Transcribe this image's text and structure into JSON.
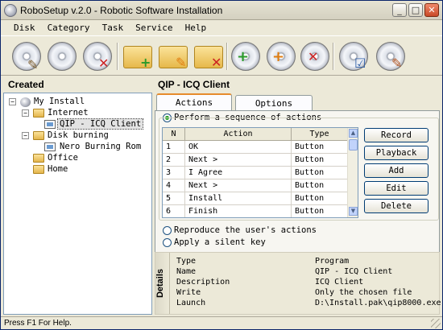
{
  "window": {
    "title": "RoboSetup v.2.0 - Robotic Software Installation",
    "minimize_icon": "minimize-icon",
    "maximize_icon": "maximize-icon",
    "close_icon": "close-icon"
  },
  "menu": [
    "Disk",
    "Category",
    "Task",
    "Service",
    "Help"
  ],
  "toolbar": {
    "buttons": [
      {
        "icon": "disk-properties-icon"
      },
      {
        "icon": "disk-icon"
      },
      {
        "icon": "disk-delete-icon"
      },
      {
        "icon": "category-add-icon"
      },
      {
        "icon": "category-edit-icon"
      },
      {
        "icon": "category-delete-icon"
      },
      {
        "icon": "task-add-icon"
      },
      {
        "icon": "task-edit-icon"
      },
      {
        "icon": "task-delete-icon"
      },
      {
        "icon": "disk-test-icon"
      },
      {
        "icon": "disk-record-icon"
      }
    ]
  },
  "left": {
    "header": "Created",
    "tree": [
      {
        "label": "My Install",
        "level": 0,
        "expanded": true,
        "type": "disk"
      },
      {
        "label": "Internet",
        "level": 1,
        "expanded": true,
        "type": "folder"
      },
      {
        "label": "QIP - ICQ Client",
        "level": 2,
        "type": "program",
        "selected": true
      },
      {
        "label": "Disk burning",
        "level": 1,
        "expanded": true,
        "type": "folder"
      },
      {
        "label": "Nero Burning Rom",
        "level": 2,
        "type": "program"
      },
      {
        "label": "Office",
        "level": 1,
        "type": "folder"
      },
      {
        "label": "Home",
        "level": 1,
        "type": "folder"
      }
    ]
  },
  "right": {
    "header": "QIP - ICQ Client",
    "tabs": [
      "Actions",
      "Options"
    ],
    "radio_sequence": "Perform a sequence of actions",
    "radio_reproduce": "Reproduce the user's actions",
    "radio_silent": "Apply a silent key",
    "table": {
      "columns": [
        "N",
        "Action",
        "Type"
      ],
      "rows": [
        {
          "n": "1",
          "action": "OK",
          "type": "Button"
        },
        {
          "n": "2",
          "action": "Next >",
          "type": "Button"
        },
        {
          "n": "3",
          "action": "I Agree",
          "type": "Button"
        },
        {
          "n": "4",
          "action": "Next >",
          "type": "Button"
        },
        {
          "n": "5",
          "action": "Install",
          "type": "Button"
        },
        {
          "n": "6",
          "action": "Finish",
          "type": "Button"
        }
      ]
    },
    "buttons": {
      "record": "Record",
      "playback": "Playback",
      "add": "Add",
      "edit": "Edit",
      "delete": "Delete"
    }
  },
  "details": {
    "title": "Details",
    "rows": [
      {
        "key": "Type",
        "value": "Program"
      },
      {
        "key": "Name",
        "value": "QIP - ICQ Client"
      },
      {
        "key": "Description",
        "value": "ICQ Client"
      },
      {
        "key": "Write",
        "value": "Only the chosen file"
      },
      {
        "key": "Launch",
        "value": "D:\\Install.pak\\qip8000.exe"
      }
    ]
  },
  "status": "Press F1 For Help."
}
